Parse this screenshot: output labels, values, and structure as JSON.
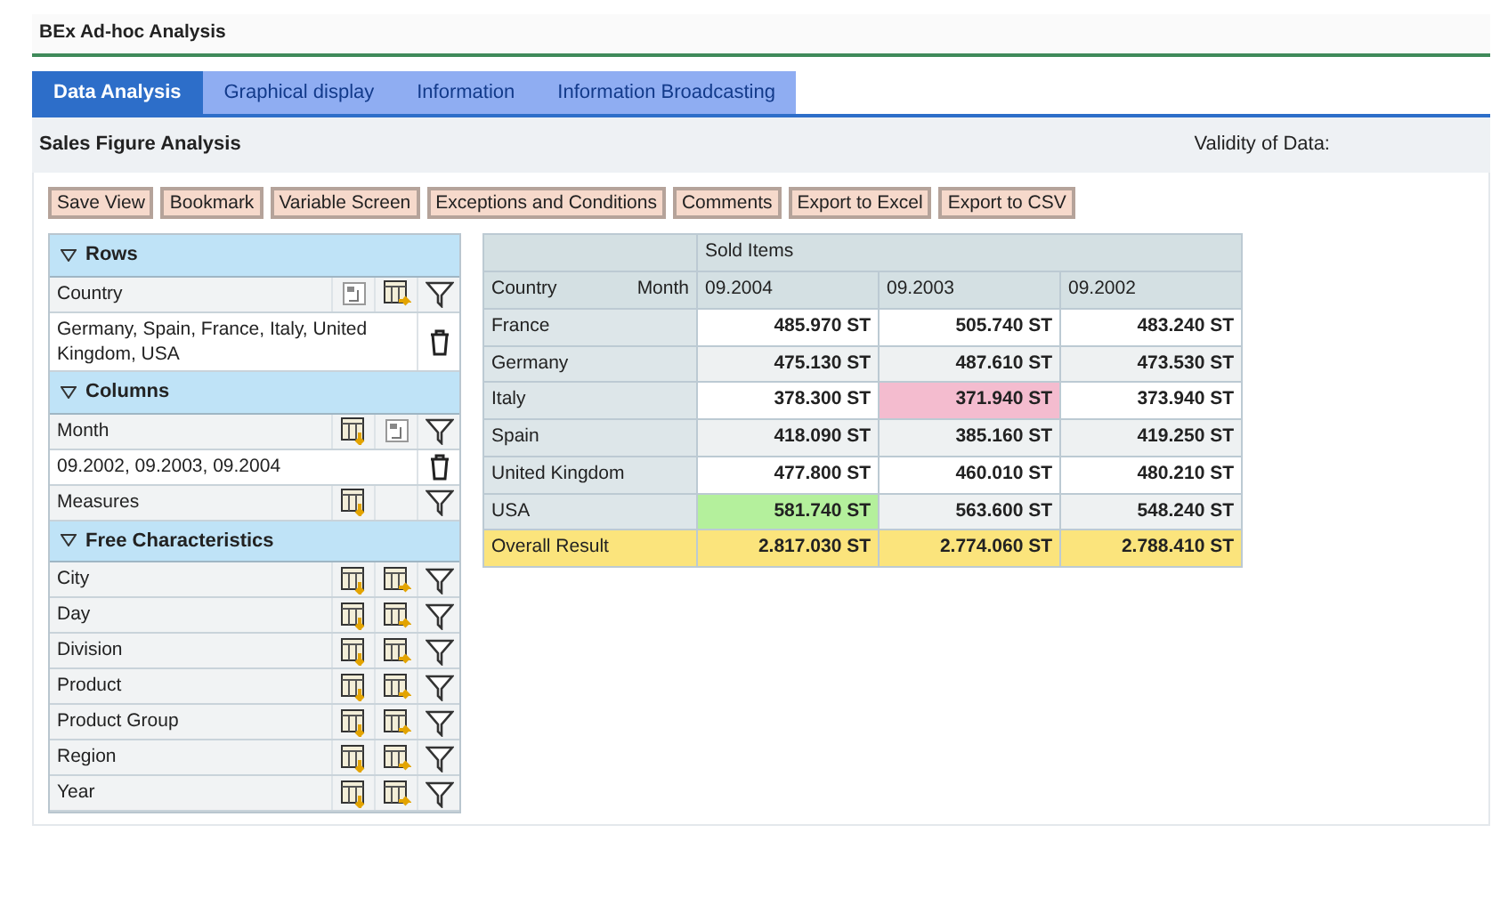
{
  "window": {
    "title": "BEx Ad-hoc Analysis"
  },
  "tabs": [
    {
      "label": "Data Analysis",
      "selected": true
    },
    {
      "label": "Graphical display",
      "selected": false
    },
    {
      "label": "Information",
      "selected": false
    },
    {
      "label": "Information Broadcasting",
      "selected": false
    }
  ],
  "header": {
    "title": "Sales Figure Analysis",
    "validity": "Validity of Data:"
  },
  "toolbar": [
    "Save View",
    "Bookmark",
    "Variable Screen",
    "Exceptions and Conditions",
    "Comments",
    "Export to Excel",
    "Export to CSV"
  ],
  "navigation": [
    {
      "title": "Rows",
      "expanded": true,
      "items": [
        {
          "kind": "field",
          "label": "Country",
          "icons": [
            {
              "kind": "swap"
            },
            {
              "kind": "move_right"
            },
            {
              "kind": "filter"
            }
          ]
        },
        {
          "kind": "filter_value",
          "label": "Germany, Spain, France, Italy, United Kingdom, USA"
        }
      ]
    },
    {
      "title": "Columns",
      "expanded": true,
      "items": [
        {
          "kind": "field",
          "label": "Month",
          "icons": [
            {
              "kind": "move_down"
            },
            {
              "kind": "swap"
            },
            {
              "kind": "filter"
            }
          ]
        },
        {
          "kind": "filter_value",
          "label": "09.2002, 09.2003, 09.2004"
        },
        {
          "kind": "field",
          "label": "Measures",
          "icons": [
            {
              "kind": "move_down"
            },
            {
              "kind": "empty"
            },
            {
              "kind": "filter"
            }
          ]
        }
      ]
    },
    {
      "title": "Free Characteristics",
      "expanded": true,
      "items": [
        {
          "kind": "field",
          "label": "City",
          "icons": [
            {
              "kind": "move_down"
            },
            {
              "kind": "move_right"
            },
            {
              "kind": "filter"
            }
          ]
        },
        {
          "kind": "field",
          "label": "Day",
          "icons": [
            {
              "kind": "move_down"
            },
            {
              "kind": "move_right"
            },
            {
              "kind": "filter"
            }
          ]
        },
        {
          "kind": "field",
          "label": "Division",
          "icons": [
            {
              "kind": "move_down"
            },
            {
              "kind": "move_right"
            },
            {
              "kind": "filter"
            }
          ]
        },
        {
          "kind": "field",
          "label": "Product",
          "icons": [
            {
              "kind": "move_down"
            },
            {
              "kind": "move_right"
            },
            {
              "kind": "filter"
            }
          ]
        },
        {
          "kind": "field",
          "label": "Product Group",
          "icons": [
            {
              "kind": "move_down"
            },
            {
              "kind": "move_right"
            },
            {
              "kind": "filter"
            }
          ]
        },
        {
          "kind": "field",
          "label": "Region",
          "icons": [
            {
              "kind": "move_down"
            },
            {
              "kind": "move_right"
            },
            {
              "kind": "filter"
            }
          ]
        },
        {
          "kind": "field",
          "label": "Year",
          "icons": [
            {
              "kind": "move_down"
            },
            {
              "kind": "move_right"
            },
            {
              "kind": "filter"
            }
          ]
        }
      ]
    }
  ],
  "table": {
    "measure": "Sold Items",
    "row_header": "Country",
    "column_header": "Month",
    "columns": [
      "09.2004",
      "09.2003",
      "09.2002"
    ],
    "rows": [
      {
        "label": "France",
        "cells": [
          {
            "value": "485.970 ST"
          },
          {
            "value": "505.740 ST"
          },
          {
            "value": "483.240 ST"
          }
        ]
      },
      {
        "label": "Germany",
        "cells": [
          {
            "value": "475.130 ST"
          },
          {
            "value": "487.610 ST"
          },
          {
            "value": "473.530 ST"
          }
        ]
      },
      {
        "label": "Italy",
        "cells": [
          {
            "value": "378.300 ST"
          },
          {
            "value": "371.940 ST",
            "color": "#f4bccf"
          },
          {
            "value": "373.940 ST"
          }
        ]
      },
      {
        "label": "Spain",
        "cells": [
          {
            "value": "418.090 ST"
          },
          {
            "value": "385.160 ST"
          },
          {
            "value": "419.250 ST"
          }
        ]
      },
      {
        "label": "United Kingdom",
        "cells": [
          {
            "value": "477.800 ST"
          },
          {
            "value": "460.010 ST"
          },
          {
            "value": "480.210 ST"
          }
        ]
      },
      {
        "label": "USA",
        "cells": [
          {
            "value": "581.740 ST",
            "color": "#b4f09c"
          },
          {
            "value": "563.600 ST"
          },
          {
            "value": "548.240 ST"
          }
        ]
      }
    ],
    "total": {
      "label": "Overall Result",
      "cells": [
        "2.817.030 ST",
        "2.774.060 ST",
        "2.788.410 ST"
      ]
    }
  }
}
